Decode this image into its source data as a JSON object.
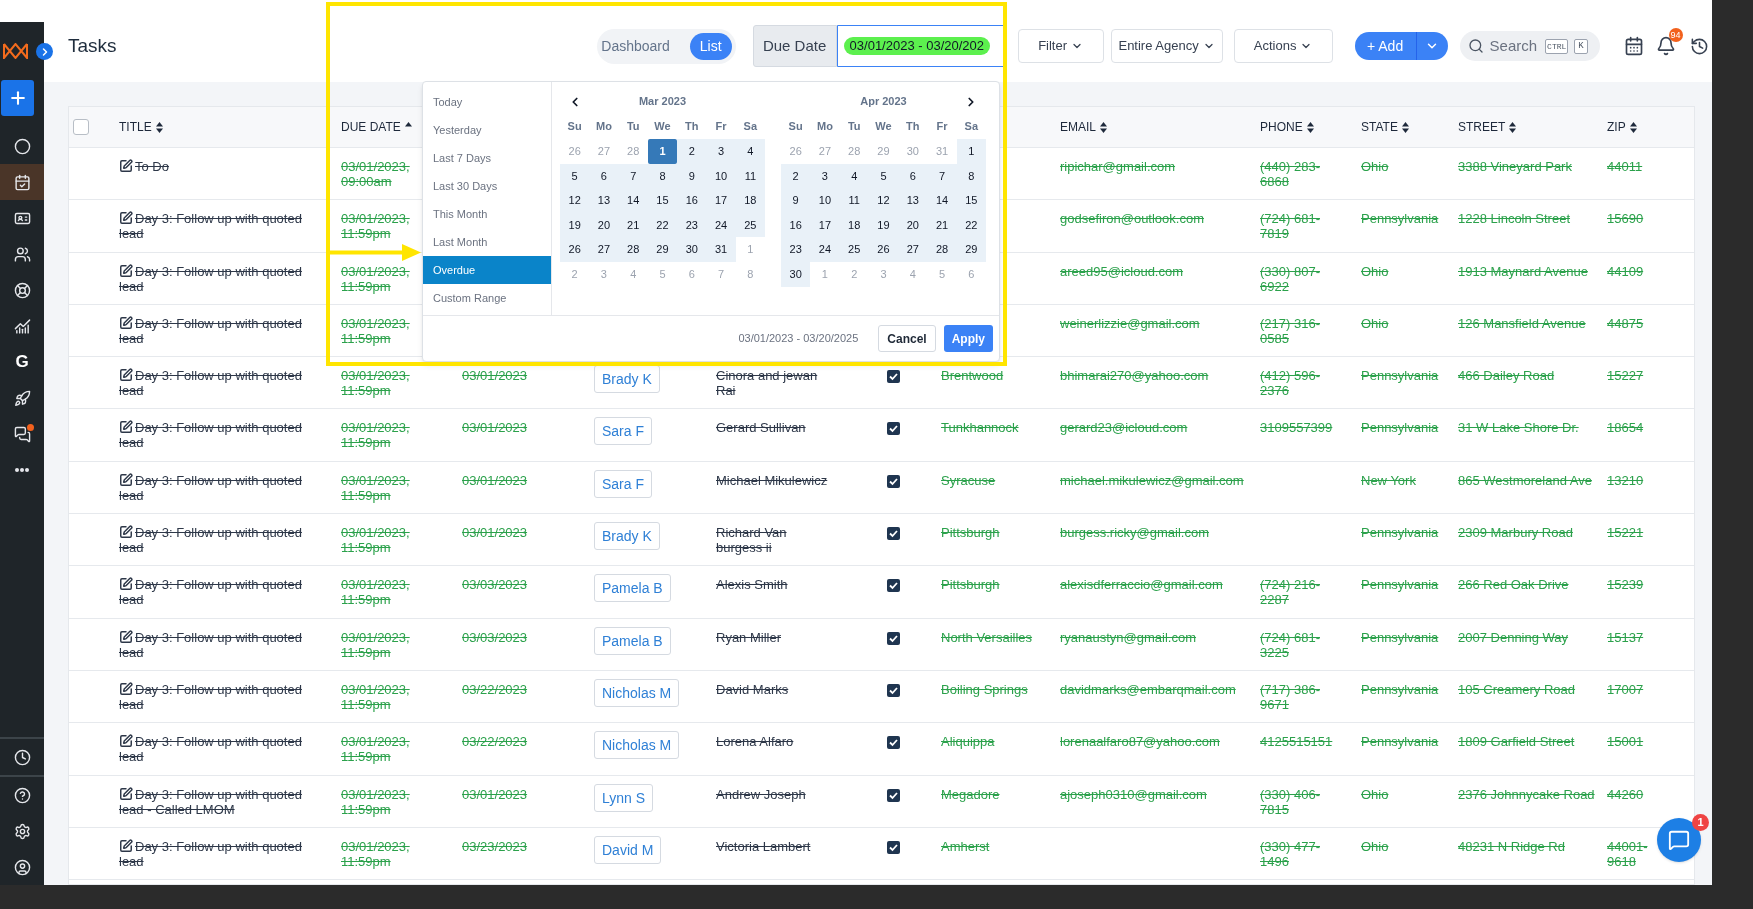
{
  "sidebar": {
    "nav": [
      {
        "kind": "icon",
        "selected": false
      },
      {
        "kind": "icon",
        "selected": true
      },
      {
        "kind": "icon",
        "selected": false
      },
      {
        "kind": "icon",
        "selected": false
      },
      {
        "kind": "icon",
        "selected": false
      },
      {
        "kind": "icon",
        "selected": false
      },
      {
        "kind": "letter",
        "label": "G",
        "selected": false
      },
      {
        "kind": "icon",
        "selected": false
      },
      {
        "kind": "icon",
        "selected": false,
        "alert": true
      },
      {
        "kind": "icon",
        "selected": false
      }
    ]
  },
  "header": {
    "title": "Tasks",
    "view_toggle": [
      {
        "label": "Dashboard",
        "selected": false
      },
      {
        "label": "List",
        "selected": true
      }
    ],
    "due_date": {
      "label": "Due Date",
      "value": "03/01/2023 - 03/20/202"
    },
    "dropdowns": [
      "Filter",
      "Entire Agency",
      "Actions"
    ],
    "add_button": "+ Add",
    "search": {
      "placeholder": "Search",
      "keys": [
        "CTRL",
        "K"
      ]
    },
    "notifications": "94"
  },
  "datepicker": {
    "ranges": [
      {
        "label": "Today",
        "selected": false
      },
      {
        "label": "Yesterday",
        "selected": false
      },
      {
        "label": "Last 7 Days",
        "selected": false
      },
      {
        "label": "Last 30 Days",
        "selected": false
      },
      {
        "label": "This Month",
        "selected": false
      },
      {
        "label": "Last Month",
        "selected": false
      },
      {
        "label": "Overdue",
        "selected": true
      },
      {
        "label": "Custom Range",
        "selected": false
      }
    ],
    "months": [
      {
        "title": "Mar 2023",
        "weekdays": [
          "Su",
          "Mo",
          "Tu",
          "We",
          "Th",
          "Fr",
          "Sa"
        ],
        "weeks": [
          [
            {
              "d": "26",
              "kind": "off"
            },
            {
              "d": "27",
              "kind": "off"
            },
            {
              "d": "28",
              "kind": "off"
            },
            {
              "d": "1",
              "kind": "start"
            },
            {
              "d": "2",
              "kind": "range"
            },
            {
              "d": "3",
              "kind": "range"
            },
            {
              "d": "4",
              "kind": "range"
            }
          ],
          [
            {
              "d": "5",
              "kind": "range"
            },
            {
              "d": "6",
              "kind": "range"
            },
            {
              "d": "7",
              "kind": "range"
            },
            {
              "d": "8",
              "kind": "range"
            },
            {
              "d": "9",
              "kind": "range"
            },
            {
              "d": "10",
              "kind": "range"
            },
            {
              "d": "11",
              "kind": "range"
            }
          ],
          [
            {
              "d": "12",
              "kind": "range"
            },
            {
              "d": "13",
              "kind": "range"
            },
            {
              "d": "14",
              "kind": "range"
            },
            {
              "d": "15",
              "kind": "range"
            },
            {
              "d": "16",
              "kind": "range"
            },
            {
              "d": "17",
              "kind": "range"
            },
            {
              "d": "18",
              "kind": "range"
            }
          ],
          [
            {
              "d": "19",
              "kind": "range"
            },
            {
              "d": "20",
              "kind": "range"
            },
            {
              "d": "21",
              "kind": "range"
            },
            {
              "d": "22",
              "kind": "range"
            },
            {
              "d": "23",
              "kind": "range"
            },
            {
              "d": "24",
              "kind": "range"
            },
            {
              "d": "25",
              "kind": "range"
            }
          ],
          [
            {
              "d": "26",
              "kind": "range"
            },
            {
              "d": "27",
              "kind": "range"
            },
            {
              "d": "28",
              "kind": "range"
            },
            {
              "d": "29",
              "kind": "range"
            },
            {
              "d": "30",
              "kind": "range"
            },
            {
              "d": "31",
              "kind": "range"
            },
            {
              "d": "1",
              "kind": "off"
            }
          ],
          [
            {
              "d": "2",
              "kind": "off"
            },
            {
              "d": "3",
              "kind": "off"
            },
            {
              "d": "4",
              "kind": "off"
            },
            {
              "d": "5",
              "kind": "off"
            },
            {
              "d": "6",
              "kind": "off"
            },
            {
              "d": "7",
              "kind": "off"
            },
            {
              "d": "8",
              "kind": "off"
            }
          ]
        ]
      },
      {
        "title": "Apr 2023",
        "weekdays": [
          "Su",
          "Mo",
          "Tu",
          "We",
          "Th",
          "Fr",
          "Sa"
        ],
        "weeks": [
          [
            {
              "d": "26",
              "kind": "off"
            },
            {
              "d": "27",
              "kind": "off"
            },
            {
              "d": "28",
              "kind": "off"
            },
            {
              "d": "29",
              "kind": "off"
            },
            {
              "d": "30",
              "kind": "off"
            },
            {
              "d": "31",
              "kind": "off"
            },
            {
              "d": "1",
              "kind": "range"
            }
          ],
          [
            {
              "d": "2",
              "kind": "range"
            },
            {
              "d": "3",
              "kind": "range"
            },
            {
              "d": "4",
              "kind": "range"
            },
            {
              "d": "5",
              "kind": "range"
            },
            {
              "d": "6",
              "kind": "range"
            },
            {
              "d": "7",
              "kind": "range"
            },
            {
              "d": "8",
              "kind": "range"
            }
          ],
          [
            {
              "d": "9",
              "kind": "range"
            },
            {
              "d": "10",
              "kind": "range"
            },
            {
              "d": "11",
              "kind": "range"
            },
            {
              "d": "12",
              "kind": "range"
            },
            {
              "d": "13",
              "kind": "range"
            },
            {
              "d": "14",
              "kind": "range"
            },
            {
              "d": "15",
              "kind": "range"
            }
          ],
          [
            {
              "d": "16",
              "kind": "range"
            },
            {
              "d": "17",
              "kind": "range"
            },
            {
              "d": "18",
              "kind": "range"
            },
            {
              "d": "19",
              "kind": "range"
            },
            {
              "d": "20",
              "kind": "range"
            },
            {
              "d": "21",
              "kind": "range"
            },
            {
              "d": "22",
              "kind": "range"
            }
          ],
          [
            {
              "d": "23",
              "kind": "range"
            },
            {
              "d": "24",
              "kind": "range"
            },
            {
              "d": "25",
              "kind": "range"
            },
            {
              "d": "26",
              "kind": "range"
            },
            {
              "d": "27",
              "kind": "range"
            },
            {
              "d": "28",
              "kind": "range"
            },
            {
              "d": "29",
              "kind": "range"
            }
          ],
          [
            {
              "d": "30",
              "kind": "range"
            },
            {
              "d": "1",
              "kind": "off"
            },
            {
              "d": "2",
              "kind": "off"
            },
            {
              "d": "3",
              "kind": "off"
            },
            {
              "d": "4",
              "kind": "off"
            },
            {
              "d": "5",
              "kind": "off"
            },
            {
              "d": "6",
              "kind": "off"
            }
          ]
        ]
      }
    ],
    "summary": "03/01/2023 - 03/20/2025",
    "buttons": [
      {
        "label": "Cancel",
        "kind": "secondary"
      },
      {
        "label": "Apply",
        "kind": "primary"
      }
    ]
  },
  "table": {
    "select_all": {
      "checked": false
    },
    "columns": [
      {
        "label": "TITLE",
        "sorted": false
      },
      {
        "label": "DUE DATE",
        "sorted": true
      },
      {
        "label": "EMAIL",
        "sorted": false
      },
      {
        "label": "PHONE",
        "sorted": false
      },
      {
        "label": "STATE",
        "sorted": false
      },
      {
        "label": "STREET",
        "sorted": false
      },
      {
        "label": "ZIP",
        "sorted": false
      }
    ],
    "rows": [
      {
        "completed": true,
        "title": "To Do",
        "due": "03/01/2023, 09:00am",
        "email": "ripichar@gmail.com",
        "phone": "(440) 283-6868",
        "state": "Ohio",
        "street": "3388 Vineyard Park",
        "zip": "44011"
      },
      {
        "completed": true,
        "title": "Day 3: Follow up with quoted lead",
        "due": "03/01/2023, 11:59pm",
        "email": "godsefiron@outlook.com",
        "phone": "(724) 681-7819",
        "state": "Pennsylvania",
        "street": "1228 Lincoln Street",
        "zip": "15690"
      },
      {
        "completed": true,
        "title": "Day 3: Follow up with quoted lead",
        "due": "03/01/2023, 11:59pm",
        "email": "areed95@icloud.com",
        "phone": "(330) 807-6922",
        "state": "Ohio",
        "street": "1913 Maynard Avenue",
        "zip": "44109"
      },
      {
        "completed": true,
        "title": "Day 3: Follow up with quoted lead",
        "due": "03/01/2023, 11:59pm",
        "email": "weinerlizzie@gmail.com",
        "phone": "(217) 316-0585",
        "state": "Ohio",
        "street": "126 Mansfield Avenue",
        "zip": "44875"
      },
      {
        "completed": true,
        "title": "Day 3: Follow up with quoted lead",
        "due": "03/01/2023, 11:59pm",
        "date": "03/01/2023",
        "assignee": "Brady K",
        "contact": "Cinora and jewan Rai",
        "done": true,
        "city": "Brentwood",
        "email": "bhimarai270@yahoo.com",
        "phone": "(412) 596-2376",
        "state": "Pennsylvania",
        "street": "466 Dailey Road",
        "zip": "15227"
      },
      {
        "completed": true,
        "title": "Day 3: Follow up with quoted lead",
        "due": "03/01/2023, 11:59pm",
        "date": "03/01/2023",
        "assignee": "Sara F",
        "contact": "Gerard Sullivan",
        "done": true,
        "city": "Tunkhannock",
        "email": "gerard23@icloud.com",
        "phone": "3109557399",
        "state": "Pennsylvania",
        "street": "31 W Lake Shore Dr.",
        "zip": "18654"
      },
      {
        "completed": true,
        "title": "Day 3: Follow up with quoted lead",
        "due": "03/01/2023, 11:59pm",
        "date": "03/01/2023",
        "assignee": "Sara F",
        "contact": "Michael Mikulewicz",
        "done": true,
        "city": "Syracuse",
        "email": "michael.mikulewicz@gmail.com",
        "state": "New York",
        "street": "865 Westmoreland Ave",
        "zip": "13210"
      },
      {
        "completed": true,
        "title": "Day 3: Follow up with quoted lead",
        "due": "03/01/2023, 11:59pm",
        "date": "03/01/2023",
        "assignee": "Brady K",
        "contact": "Richard Van burgess ii",
        "done": true,
        "city": "Pittsburgh",
        "email": "burgess.ricky@gmail.com",
        "state": "Pennsylvania",
        "street": "2309 Marbury Road",
        "zip": "15221"
      },
      {
        "completed": true,
        "title": "Day 3: Follow up with quoted lead",
        "due": "03/01/2023, 11:59pm",
        "date": "03/03/2023",
        "assignee": "Pamela B",
        "contact": "Alexis Smith",
        "done": true,
        "city": "Pittsburgh",
        "email": "alexisdferraccio@gmail.com",
        "phone": "(724) 216-2287",
        "state": "Pennsylvania",
        "street": "266 Red Oak Drive",
        "zip": "15239"
      },
      {
        "completed": true,
        "title": "Day 3: Follow up with quoted lead",
        "due": "03/01/2023, 11:59pm",
        "date": "03/03/2023",
        "assignee": "Pamela B",
        "contact": "Ryan Miller",
        "done": true,
        "city": "North Versailles",
        "email": "ryanaustyn@gmail.com",
        "phone": "(724) 681-3225",
        "state": "Pennsylvania",
        "street": "2007 Denning Way",
        "zip": "15137"
      },
      {
        "completed": true,
        "title": "Day 3: Follow up with quoted lead",
        "due": "03/01/2023, 11:59pm",
        "date": "03/22/2023",
        "assignee": "Nicholas M",
        "contact": "David Marks",
        "done": true,
        "city": "Boiling Springs",
        "email": "davidmarks@embarqmail.com",
        "phone": "(717) 386-9671",
        "state": "Pennsylvania",
        "street": "105 Creamery Road",
        "zip": "17007"
      },
      {
        "completed": true,
        "title": "Day 3: Follow up with quoted lead",
        "due": "03/01/2023, 11:59pm",
        "date": "03/22/2023",
        "assignee": "Nicholas M",
        "contact": "Lorena Alfaro",
        "done": true,
        "city": "Aliquippa",
        "email": "lorenaalfaro87@yahoo.com",
        "phone": "4125515151",
        "state": "Pennsylvania",
        "street": "1809 Garfield Street",
        "zip": "15001"
      },
      {
        "completed": true,
        "title": "Day 3: Follow up with quoted lead - Called LMOM",
        "due": "03/01/2023, 11:59pm",
        "date": "03/01/2023",
        "assignee": "Lynn S",
        "contact": "Andrew Joseph",
        "done": true,
        "city": "Megadore",
        "email": "ajoseph0310@gmail.com",
        "phone": "(330) 406-7815",
        "state": "Ohio",
        "street": "2376 Johnnycake Road",
        "zip": "44260"
      },
      {
        "completed": true,
        "title": "Day 3: Follow up with quoted lead",
        "due": "03/01/2023, 11:59pm",
        "date": "03/23/2023",
        "assignee": "David M",
        "contact": "Victoria Lambert",
        "done": true,
        "city": "Amherst",
        "phone": "(330) 477-1496",
        "state": "Ohio",
        "street": "48231 N Ridge Rd",
        "zip": "44001-9618"
      }
    ]
  },
  "chat_widget": {
    "badge": "1"
  }
}
